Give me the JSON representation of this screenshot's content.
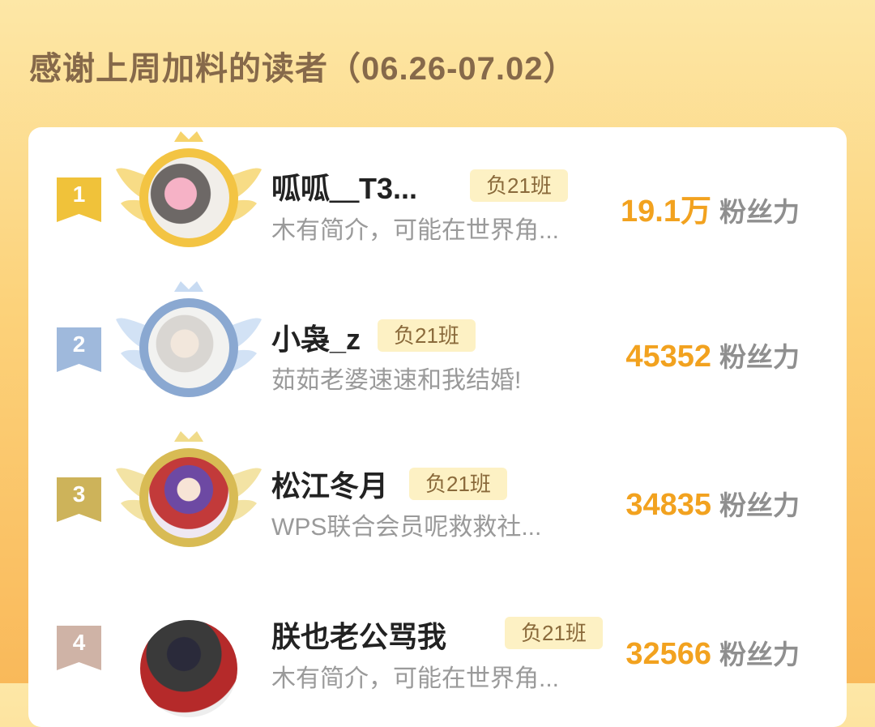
{
  "title": "感谢上周加料的读者（06.26-07.02）",
  "readers": [
    {
      "rank": "1",
      "name": "呱呱＿T3...",
      "tag": "负21班",
      "bio": "木有简介，可能在世界角...",
      "fans_value": "19.1万",
      "fans_unit": "粉丝力"
    },
    {
      "rank": "2",
      "name": "小袅_z",
      "tag": "负21班",
      "bio": "茹茹老婆速速和我结婚!",
      "fans_value": "45352",
      "fans_unit": "粉丝力"
    },
    {
      "rank": "3",
      "name": "松江冬月",
      "tag": "负21班",
      "bio": "WPS联合会员呢救救社...",
      "fans_value": "34835",
      "fans_unit": "粉丝力"
    },
    {
      "rank": "4",
      "name": "朕也老公骂我",
      "tag": "负21班",
      "bio": "木有简介，可能在世界角...",
      "fans_value": "32566",
      "fans_unit": "粉丝力"
    }
  ],
  "colors": {
    "gold": "#f0c23a",
    "silver": "#9fb9dc",
    "bronze": "#cdb35a",
    "plain": "#cfb3a6",
    "accent": "#f2a21f"
  }
}
